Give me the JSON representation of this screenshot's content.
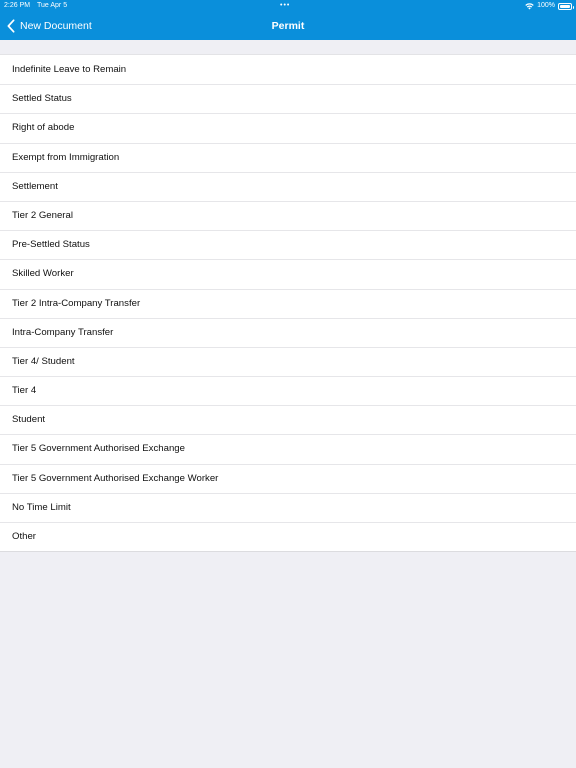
{
  "status_bar": {
    "time": "2:26 PM",
    "date": "Tue Apr 5",
    "dots": "•••",
    "battery": "100%"
  },
  "nav": {
    "back_label": "New Document",
    "title": "Permit"
  },
  "options": [
    "Indefinite Leave to Remain",
    "Settled Status",
    "Right of abode",
    "Exempt from Immigration",
    "Settlement",
    "Tier 2 General",
    "Pre-Settled Status",
    "Skilled Worker",
    "Tier 2 Intra-Company Transfer",
    "Intra-Company Transfer",
    "Tier 4/ Student",
    "Tier 4",
    "Student",
    "Tier 5 Government Authorised Exchange",
    "Tier 5 Government Authorised Exchange Worker",
    "No Time Limit",
    "Other"
  ],
  "colors": {
    "header": "#0a8fdb",
    "background": "#efeff4",
    "list_bg": "#ffffff"
  }
}
